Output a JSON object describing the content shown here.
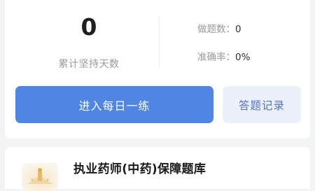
{
  "stats": {
    "streak_days": "0",
    "streak_label": "累计坚持天数",
    "questions_done_label": "做题数：",
    "questions_done_value": "0",
    "accuracy_label": "准确率：",
    "accuracy_value": "0%"
  },
  "actions": {
    "daily_practice_label": "进入每日一练",
    "answer_records_label": "答题记录"
  },
  "question_bank": {
    "title": "执业药师(中药)保障题库",
    "icon": "book-thumbnail-icon"
  },
  "colors": {
    "primary": "#4f86e6",
    "secondary_bg": "#ecf0fb",
    "secondary_text": "#4f72c8",
    "page_bg": "#f3f4f6"
  }
}
